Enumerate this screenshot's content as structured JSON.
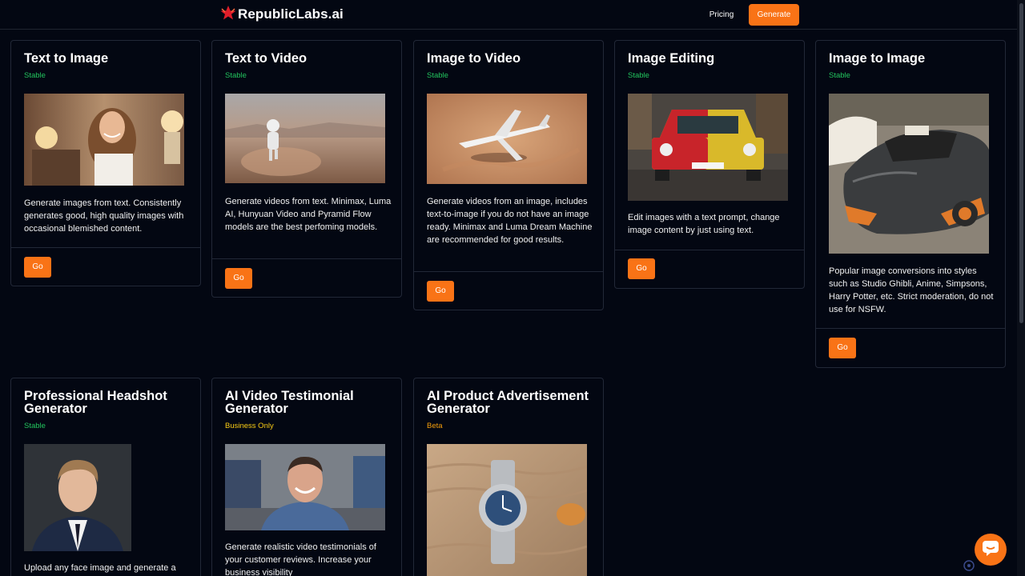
{
  "header": {
    "brand": "RepublicLabs.ai",
    "nav": {
      "pricing": "Pricing",
      "generate": "Generate"
    }
  },
  "cards": [
    {
      "title": "Text to Image",
      "status": "Stable",
      "description": "Generate images from text. Consistently generates good, high quality images with occasional blemished content.",
      "button": "Go"
    },
    {
      "title": "Text to Video",
      "status": "Stable",
      "description": "Generate videos from text. Minimax, Luma AI, Hunyuan Video and Pyramid Flow models are the best perfoming models.",
      "button": "Go"
    },
    {
      "title": "Image to Video",
      "status": "Stable",
      "description": "Generate videos from an image, includes text-to-image if you do not have an image ready. Minimax and Luma Dream Machine are recommended for good results.",
      "button": "Go"
    },
    {
      "title": "Image Editing",
      "status": "Stable",
      "description": "Edit images with a text prompt, change image content by just using text.",
      "button": "Go"
    },
    {
      "title": "Image to Image",
      "status": "Stable",
      "description": "Popular image conversions into styles such as Studio Ghibli, Anime, Simpsons, Harry Potter, etc. Strict moderation, do not use for NSFW.",
      "button": "Go"
    },
    {
      "title": "Professional Headshot Generator",
      "status": "Stable",
      "description": "Upload any face image and generate a"
    },
    {
      "title": "AI Video Testimonial Generator",
      "status": "Business Only",
      "description": "Generate realistic video testimonials of your customer reviews. Increase your business visibility"
    },
    {
      "title": "AI Product Advertisement Generator",
      "status": "Beta"
    }
  ],
  "colors": {
    "accent": "#f97316",
    "stable": "#22c55e",
    "business": "#facc15",
    "beta": "#f59e0b",
    "background": "#030712"
  },
  "icons": {
    "logo": "red-star-logo-icon",
    "chat": "chat-bubble-icon"
  }
}
